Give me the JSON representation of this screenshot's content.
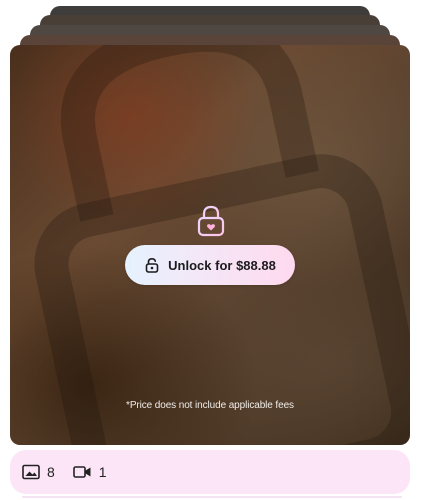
{
  "card": {
    "unlock_label": "Unlock for $88.88",
    "fee_note": "*Price does not include applicable fees",
    "lock_icon": "lock-heart-icon",
    "unlock_icon": "unlock-icon"
  },
  "footer": {
    "photos": {
      "icon": "image-icon",
      "count": "8"
    },
    "videos": {
      "icon": "video-camera-icon",
      "count": "1"
    }
  },
  "colors": {
    "button_gradient_start": "#e6f2ff",
    "button_gradient_end": "#ffd9ef",
    "footer_bg": "#fde5f8"
  }
}
